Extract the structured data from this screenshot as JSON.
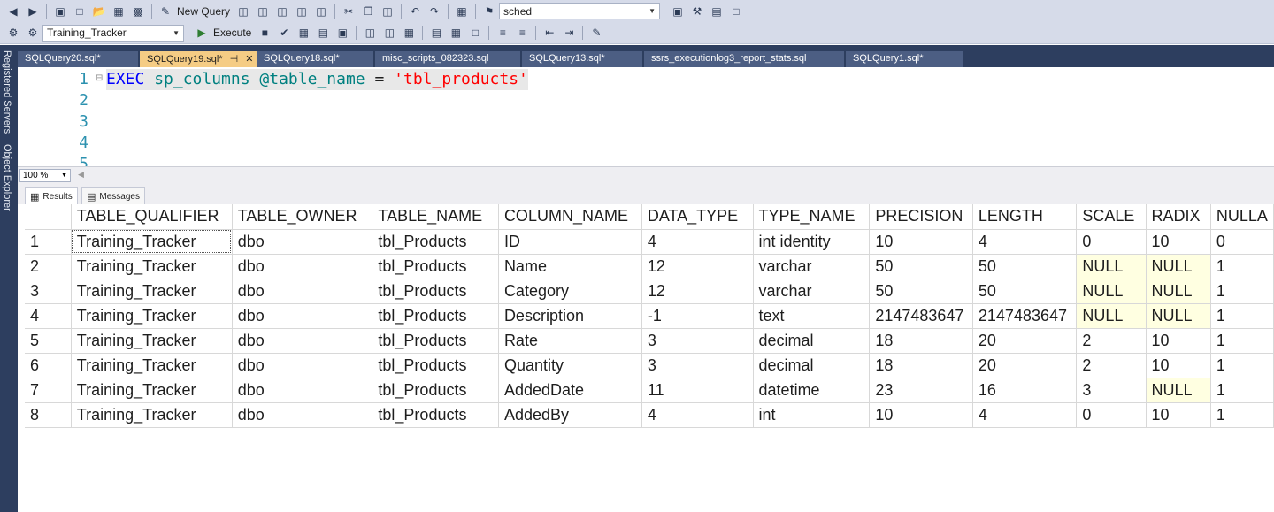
{
  "toolbar1": {
    "new_query_label": "New Query",
    "search_combo_value": "sched"
  },
  "toolbar2": {
    "database_combo_value": "Training_Tracker",
    "execute_label": "Execute"
  },
  "side_rail": {
    "registered_servers": "Registered Servers",
    "object_explorer": "Object Explorer"
  },
  "doc_tabs": [
    {
      "label": "SQLQuery20.sql*"
    },
    {
      "label": "SQLQuery19.sql*",
      "active": true
    },
    {
      "label": "SQLQuery18.sql*"
    },
    {
      "label": "misc_scripts_082323.sql"
    },
    {
      "label": "SQLQuery13.sql*"
    },
    {
      "label": "ssrs_executionlog3_report_stats.sql"
    },
    {
      "label": "SQLQuery1.sql*"
    }
  ],
  "editor": {
    "line_numbers": [
      "1",
      "2",
      "3",
      "4",
      "5"
    ],
    "line1": {
      "kw": "EXEC",
      "proc": "sp_columns",
      "param": "@table_name",
      "eq": "=",
      "str": "'tbl_products'"
    }
  },
  "zoom": "100 %",
  "result_tabs": {
    "results": "Results",
    "messages": "Messages"
  },
  "grid": {
    "columns": [
      "TABLE_QUALIFIER",
      "TABLE_OWNER",
      "TABLE_NAME",
      "COLUMN_NAME",
      "DATA_TYPE",
      "TYPE_NAME",
      "PRECISION",
      "LENGTH",
      "SCALE",
      "RADIX",
      "NULLA"
    ],
    "rows": [
      [
        "1",
        "Training_Tracker",
        "dbo",
        "tbl_Products",
        "ID",
        "4",
        "int identity",
        "10",
        "4",
        "0",
        "10",
        "0"
      ],
      [
        "2",
        "Training_Tracker",
        "dbo",
        "tbl_Products",
        "Name",
        "12",
        "varchar",
        "50",
        "50",
        "NULL",
        "NULL",
        "1"
      ],
      [
        "3",
        "Training_Tracker",
        "dbo",
        "tbl_Products",
        "Category",
        "12",
        "varchar",
        "50",
        "50",
        "NULL",
        "NULL",
        "1"
      ],
      [
        "4",
        "Training_Tracker",
        "dbo",
        "tbl_Products",
        "Description",
        "-1",
        "text",
        "2147483647",
        "2147483647",
        "NULL",
        "NULL",
        "1"
      ],
      [
        "5",
        "Training_Tracker",
        "dbo",
        "tbl_Products",
        "Rate",
        "3",
        "decimal",
        "18",
        "20",
        "2",
        "10",
        "1"
      ],
      [
        "6",
        "Training_Tracker",
        "dbo",
        "tbl_Products",
        "Quantity",
        "3",
        "decimal",
        "18",
        "20",
        "2",
        "10",
        "1"
      ],
      [
        "7",
        "Training_Tracker",
        "dbo",
        "tbl_Products",
        "AddedDate",
        "11",
        "datetime",
        "23",
        "16",
        "3",
        "NULL",
        "1"
      ],
      [
        "8",
        "Training_Tracker",
        "dbo",
        "tbl_Products",
        "AddedBy",
        "4",
        "int",
        "10",
        "4",
        "0",
        "10",
        "1"
      ]
    ]
  },
  "colors": {
    "chrome": "#d6dbe9",
    "tab_strip": "#2d3e5f",
    "active_tab": "#f5cc84",
    "null_cell": "#ffffe1",
    "keyword": "#0000ff",
    "identifier": "#008080",
    "string": "#ff0000"
  }
}
